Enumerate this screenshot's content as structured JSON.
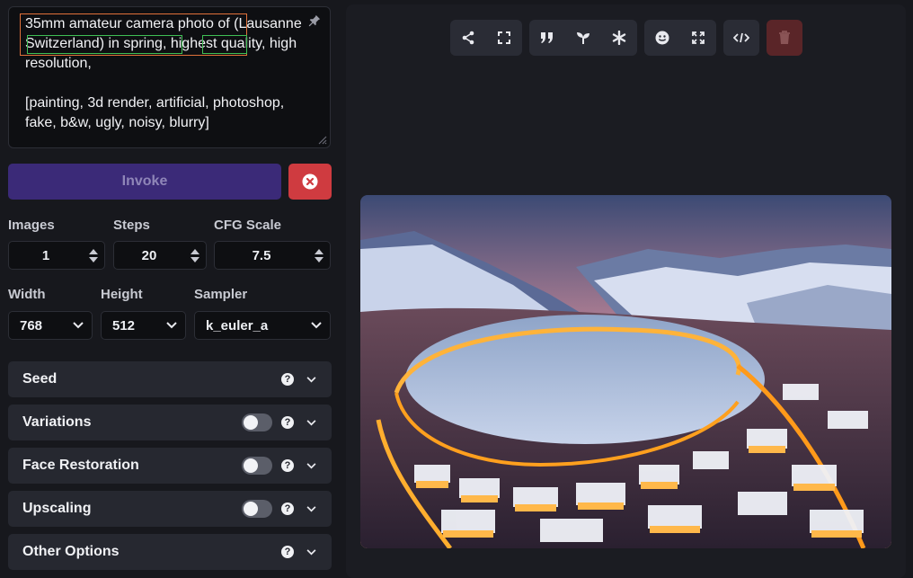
{
  "prompt": {
    "text": "35mm amateur camera photo of (Lausanne Switzerland) in spring, highest quality, high resolution,\n\n[painting, 3d render, artificial, photoshop, fake, b&w, ugly, noisy, blurry]"
  },
  "actions": {
    "invoke_label": "Invoke"
  },
  "params": {
    "images": {
      "label": "Images",
      "value": "1"
    },
    "steps": {
      "label": "Steps",
      "value": "20"
    },
    "cfg": {
      "label": "CFG Scale",
      "value": "7.5"
    },
    "width": {
      "label": "Width",
      "value": "768"
    },
    "height": {
      "label": "Height",
      "value": "512"
    },
    "sampler": {
      "label": "Sampler",
      "value": "k_euler_a"
    }
  },
  "sections": [
    {
      "title": "Seed",
      "has_toggle": false,
      "toggle_on": false
    },
    {
      "title": "Variations",
      "has_toggle": true,
      "toggle_on": false
    },
    {
      "title": "Face Restoration",
      "has_toggle": true,
      "toggle_on": false
    },
    {
      "title": "Upscaling",
      "has_toggle": true,
      "toggle_on": false
    },
    {
      "title": "Other Options",
      "has_toggle": false,
      "toggle_on": false
    }
  ],
  "toolbar": {
    "icons": [
      "share-icon",
      "fullscreen-icon",
      "quote-icon",
      "seedling-icon",
      "asterisk-icon",
      "face-icon",
      "expand-icon",
      "code-icon",
      "trash-icon"
    ]
  },
  "colors": {
    "invoke_bg": "#3b2a78",
    "cancel_bg": "#cf3b40",
    "trash_bg": "#5a2528",
    "highlight_orange": "#e0713a",
    "highlight_green": "#3fbf54"
  }
}
